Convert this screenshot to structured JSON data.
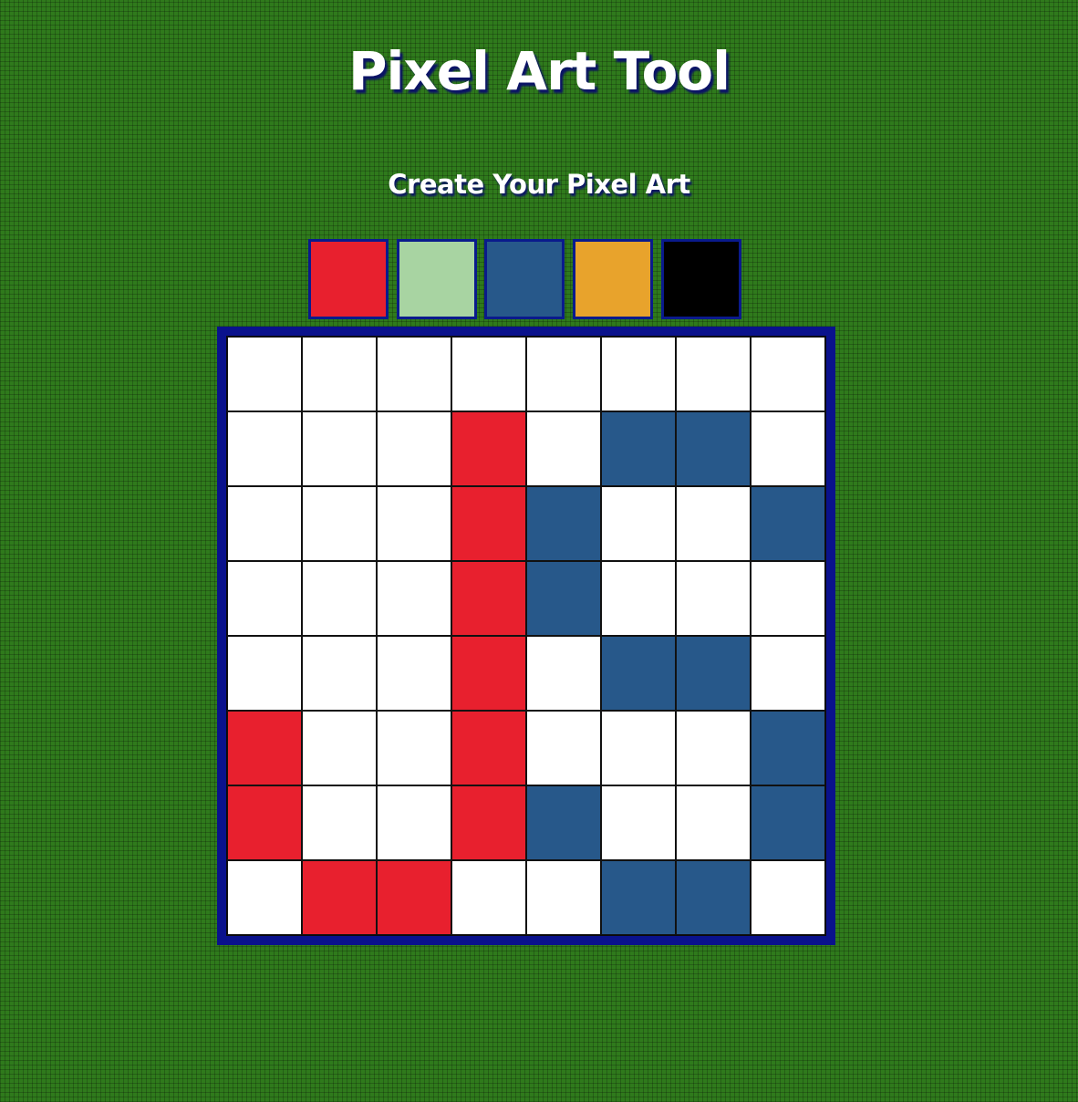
{
  "header": {
    "title": "Pixel Art Tool",
    "subtitle": "Create Your Pixel Art"
  },
  "palette": [
    {
      "name": "red",
      "color": "#e8202e"
    },
    {
      "name": "light-green",
      "color": "#a8d4a2"
    },
    {
      "name": "blue",
      "color": "#27588a"
    },
    {
      "name": "orange",
      "color": "#e8a32c"
    },
    {
      "name": "black",
      "color": "#000000"
    }
  ],
  "canvas": {
    "colors": {
      "W": "#ffffff",
      "R": "#e8202e",
      "B": "#27588a"
    },
    "rows": [
      [
        "W",
        "W",
        "W",
        "W",
        "W",
        "W",
        "W",
        "W"
      ],
      [
        "W",
        "W",
        "W",
        "R",
        "W",
        "B",
        "B",
        "W"
      ],
      [
        "W",
        "W",
        "W",
        "R",
        "B",
        "W",
        "W",
        "B"
      ],
      [
        "W",
        "W",
        "W",
        "R",
        "B",
        "W",
        "W",
        "W"
      ],
      [
        "W",
        "W",
        "W",
        "R",
        "W",
        "B",
        "B",
        "W"
      ],
      [
        "R",
        "W",
        "W",
        "R",
        "W",
        "W",
        "W",
        "B"
      ],
      [
        "R",
        "W",
        "W",
        "R",
        "B",
        "W",
        "W",
        "B"
      ],
      [
        "W",
        "R",
        "R",
        "W",
        "W",
        "B",
        "B",
        "W"
      ]
    ]
  }
}
